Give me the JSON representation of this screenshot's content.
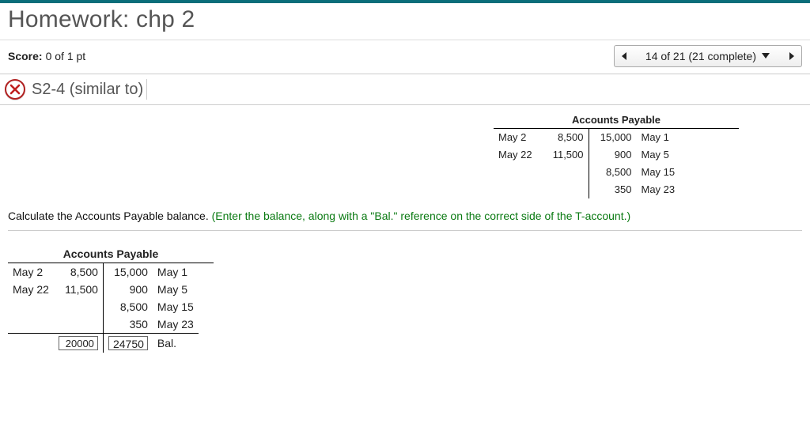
{
  "header": {
    "title": "Homework: chp 2",
    "score_label": "Score:",
    "score_value": "0 of 1 pt",
    "progress": "14 of 21 (21 complete)"
  },
  "question": {
    "ref": "S2-4 (similar to)",
    "prompt_black": "Calculate the Accounts Payable balance. ",
    "prompt_green": "(Enter the balance, along with a \"Bal.\" reference on the correct side of the T-account.)"
  },
  "top_t": {
    "title": "Accounts Payable",
    "debits": [
      {
        "date": "May 2",
        "amount": "8,500"
      },
      {
        "date": "May 22",
        "amount": "11,500"
      }
    ],
    "credits": [
      {
        "amount": "15,000",
        "date": "May 1"
      },
      {
        "amount": "900",
        "date": "May 5"
      },
      {
        "amount": "8,500",
        "date": "May 15"
      },
      {
        "amount": "350",
        "date": "May 23"
      }
    ]
  },
  "bottom_t": {
    "title": "Accounts Payable",
    "debits": [
      {
        "date": "May 2",
        "amount": "8,500"
      },
      {
        "date": "May 22",
        "amount": "11,500"
      }
    ],
    "credits": [
      {
        "amount": "15,000",
        "date": "May 1"
      },
      {
        "amount": "900",
        "date": "May 5"
      },
      {
        "amount": "8,500",
        "date": "May 15"
      },
      {
        "amount": "350",
        "date": "May 23"
      }
    ],
    "debit_total_input": "20000",
    "credit_total": "24750",
    "bal_label": "Bal."
  }
}
